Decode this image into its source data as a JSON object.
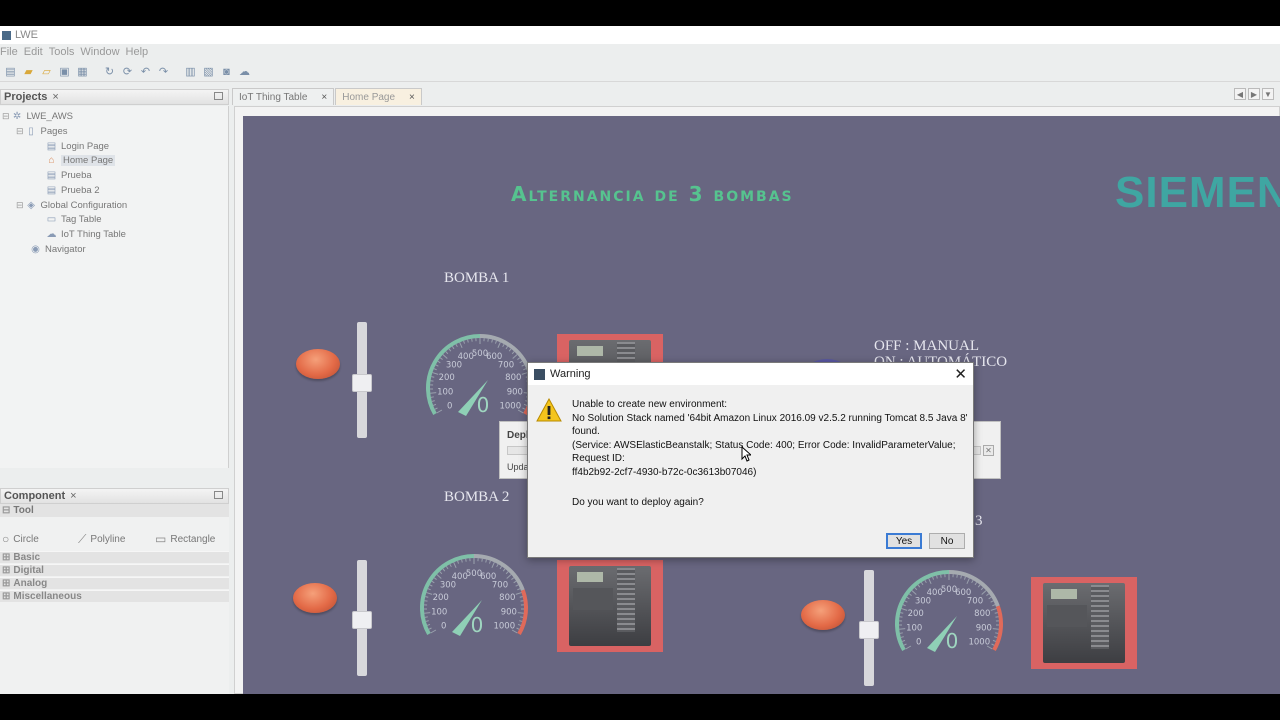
{
  "window": {
    "title": "LWE"
  },
  "menu": [
    "File",
    "Edit",
    "Tools",
    "Window",
    "Help"
  ],
  "projects_panel": {
    "title": "Projects",
    "tree": [
      {
        "label": "LWE_AWS",
        "icon": "network-icon",
        "level": 0
      },
      {
        "label": "Pages",
        "icon": "pages-icon",
        "level": 1
      },
      {
        "label": "Login Page",
        "icon": "page-icon",
        "level": 2
      },
      {
        "label": "Home Page",
        "icon": "home-icon",
        "level": 2
      },
      {
        "label": "Prueba",
        "icon": "page-icon",
        "level": 2
      },
      {
        "label": "Prueba 2",
        "icon": "page-icon",
        "level": 2
      },
      {
        "label": "Global Configuration",
        "icon": "tags-icon",
        "level": 1
      },
      {
        "label": "Tag Table",
        "icon": "tag-icon",
        "level": 2
      },
      {
        "label": "IoT Thing Table",
        "icon": "cloud-icon",
        "level": 2
      },
      {
        "label": "Navigator",
        "icon": "navigator-icon",
        "level": 1
      }
    ]
  },
  "component_panel": {
    "title": "Component",
    "tool_header": "Tool",
    "tools": [
      {
        "label": "Circle",
        "icon": "circle-icon"
      },
      {
        "label": "Polyline",
        "icon": "polyline-icon"
      },
      {
        "label": "Rectangle",
        "icon": "rectangle-icon"
      }
    ],
    "groups": [
      "Basic",
      "Digital",
      "Analog",
      "Miscellaneous"
    ]
  },
  "tabs": [
    {
      "label": "IoT Thing Table",
      "active": false
    },
    {
      "label": "Home Page",
      "active": true
    }
  ],
  "hmi": {
    "title": "Alternancia de 3 bombas",
    "brand": "SIEMEN",
    "pumps": [
      {
        "label": "BOMBA 1"
      },
      {
        "label": "BOMBA 2"
      },
      {
        "label": "3"
      }
    ],
    "legend_line1": "OFF : MANUAL",
    "legend_line2": "ON : AUTOMÁTICO",
    "gauge_ticks": [
      "0",
      "100",
      "200",
      "300",
      "400",
      "500",
      "600",
      "700",
      "800",
      "900",
      "1000"
    ],
    "gauge_value": "0"
  },
  "deploy_dialog": {
    "title": "Deploy",
    "status": "Updating"
  },
  "warning_dialog": {
    "title": "Warning",
    "line1": "Unable to create new environment:",
    "line2": "No Solution Stack named '64bit Amazon Linux 2016.09 v2.5.2 running Tomcat 8.5 Java 8' found.",
    "line3": "(Service: AWSElasticBeanstalk; Status Code: 400; Error Code: InvalidParameterValue; Request ID:",
    "line4": "ff4b2b92-2cf7-4930-b72c-0c3613b07046)",
    "question": "Do you want to deploy again?",
    "yes_label": "Yes",
    "no_label": "No"
  }
}
